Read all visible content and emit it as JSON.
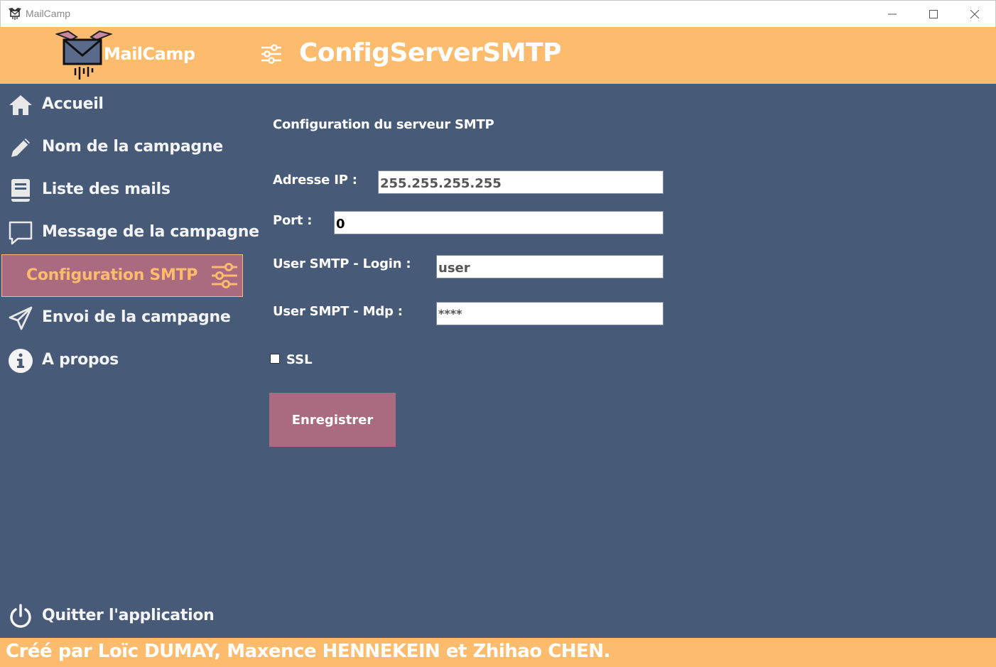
{
  "window": {
    "title": "MailCamp",
    "icon": "mailcamp-small-icon",
    "controls": [
      "minimize-icon",
      "maximize-icon",
      "close-icon"
    ]
  },
  "header": {
    "brand": "MailCamp",
    "page_icon": "sliders-icon",
    "page_title": "ConfigServerSMTP"
  },
  "sidebar": {
    "items": [
      {
        "label": "Accueil",
        "icon": "home-icon",
        "active": false
      },
      {
        "label": "Nom de la campagne",
        "icon": "pencil-icon",
        "active": false
      },
      {
        "label": "Liste des mails",
        "icon": "book-icon",
        "active": false
      },
      {
        "label": "Message de la campagne",
        "icon": "message-icon",
        "active": false
      },
      {
        "label": "Configuration SMTP",
        "icon": "sliders-icon",
        "active": true
      },
      {
        "label": "Envoi de la campagne",
        "icon": "send-icon",
        "active": false
      },
      {
        "label": "A propos",
        "icon": "info-icon",
        "active": false
      }
    ],
    "quit": {
      "label": "Quitter l'application",
      "icon": "power-icon"
    }
  },
  "form": {
    "section_title": "Configuration du serveur SMTP",
    "ip": {
      "label": "Adresse IP :",
      "value": "255.255.255.255"
    },
    "port": {
      "label": "Port :",
      "value": "0"
    },
    "login": {
      "label": "User SMTP - Login :",
      "value": "user"
    },
    "password": {
      "label": "User SMPT - Mdp :",
      "value": "****"
    },
    "ssl": {
      "label": "SSL",
      "checked": false
    },
    "save_label": "Enregistrer"
  },
  "footer": {
    "credits": "Créé par Loïc DUMAY, Maxence HENNEKEIN et Zhihao CHEN."
  },
  "colors": {
    "accent": "#fcbb6d",
    "background": "#475a78",
    "active_item": "#aa6a7f"
  }
}
